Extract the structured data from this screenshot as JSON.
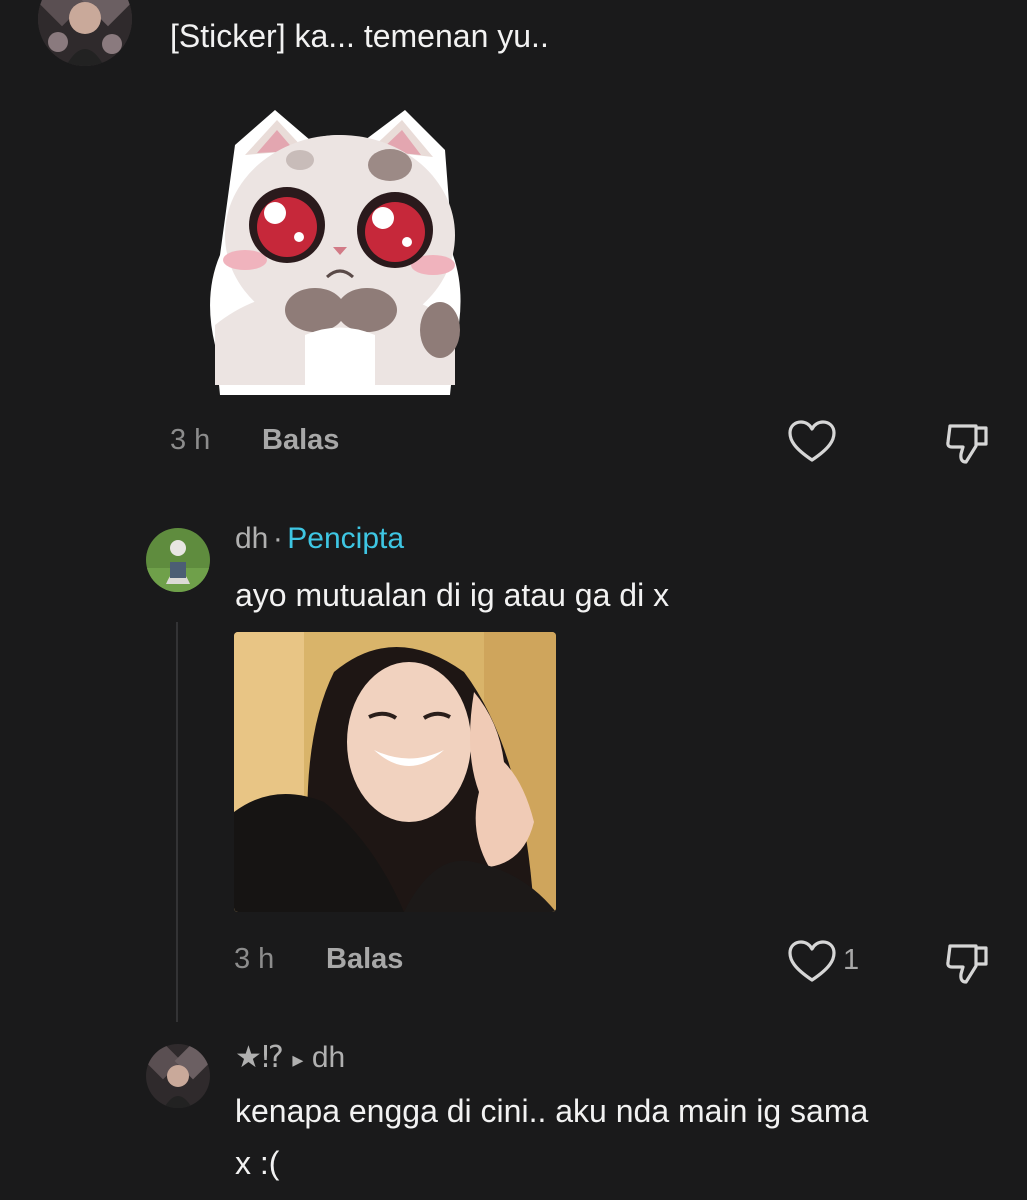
{
  "comment1": {
    "text": "[Sticker] ka... temenan yu..",
    "time": "3 h",
    "reply_label": "Balas",
    "sticker_icon": "cat-sticker"
  },
  "reply1": {
    "username": "dh",
    "separator": "·",
    "badge": "Pencipta",
    "text": "ayo mutualan di ig atau ga di x",
    "time": "3 h",
    "reply_label": "Balas",
    "like_count": "1",
    "photo_icon": "selfie-photo"
  },
  "reply2": {
    "username": "★⁉",
    "arrow": "▸",
    "reply_to": "dh",
    "text_line1": "kenapa engga di cini.. aku nda main ig sama",
    "text_line2": "x :("
  },
  "colors": {
    "background": "#1a1a1b",
    "creator_badge": "#3ec6e3",
    "muted_text": "#8c8c8c"
  }
}
